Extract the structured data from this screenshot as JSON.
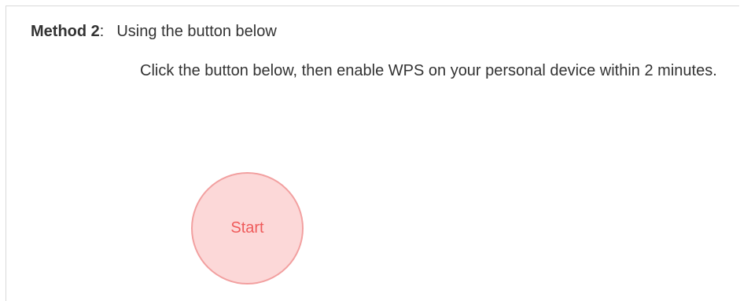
{
  "method": {
    "label": "Method 2",
    "colon": ":",
    "title": "Using the button below"
  },
  "instruction": "Click the button below, then enable WPS on your personal device within 2 minutes.",
  "start_button": {
    "label": "Start"
  },
  "colors": {
    "button_fill": "#fcd8d8",
    "button_border": "#f2a0a0",
    "button_text": "#ef5b5b"
  }
}
